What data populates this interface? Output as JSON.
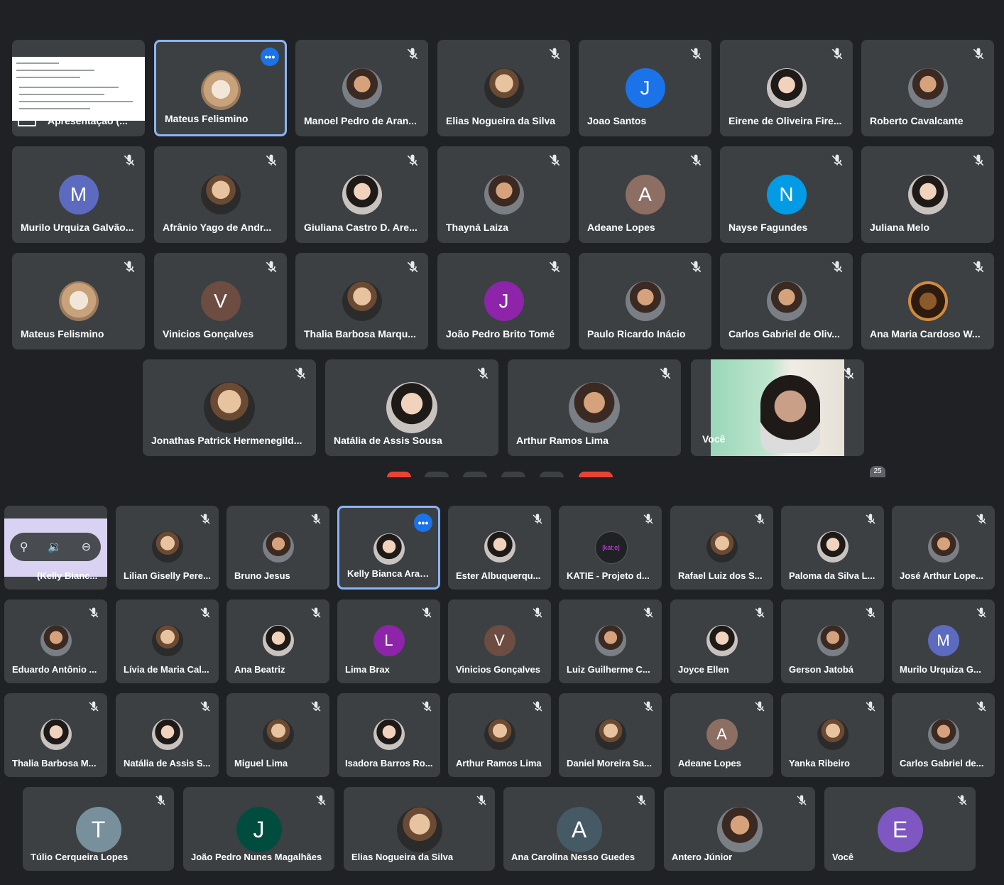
{
  "colors": {
    "background": "#202124",
    "tile": "#3c4043",
    "active_border": "#8ab4f8",
    "accent": "#1a73e8"
  },
  "top_grid": {
    "presentation": {
      "caption": "Apresentação (..."
    },
    "rows": [
      [
        {
          "name": "Mateus Felismino",
          "kind": "photo",
          "style": "cat",
          "active": true,
          "more": true
        },
        {
          "name": "Manoel Pedro de Aran...",
          "kind": "photo",
          "style": "p2"
        },
        {
          "name": "Elias Nogueira da Silva",
          "kind": "photo",
          "style": "p1"
        },
        {
          "name": "Joao Santos",
          "kind": "letter",
          "letter": "J",
          "color": "#1a73e8"
        },
        {
          "name": "Eirene de Oliveira Fire...",
          "kind": "photo",
          "style": "p3"
        },
        {
          "name": "Roberto Cavalcante",
          "kind": "photo",
          "style": "p2"
        }
      ],
      [
        {
          "name": "Murilo Urquiza Galvão...",
          "kind": "letter",
          "letter": "M",
          "color": "#5c6bc0"
        },
        {
          "name": "Afrânio Yago de Andr...",
          "kind": "photo",
          "style": "p1"
        },
        {
          "name": "Giuliana Castro D. Are...",
          "kind": "photo",
          "style": "p3"
        },
        {
          "name": "Thayná Laiza",
          "kind": "photo",
          "style": "p2"
        },
        {
          "name": "Adeane Lopes",
          "kind": "letter",
          "letter": "A",
          "color": "#8d6e63"
        },
        {
          "name": "Nayse Fagundes",
          "kind": "letter",
          "letter": "N",
          "color": "#039be5"
        },
        {
          "name": "Juliana Melo",
          "kind": "photo",
          "style": "p3"
        }
      ],
      [
        {
          "name": "Mateus Felismino",
          "kind": "photo",
          "style": "cat"
        },
        {
          "name": "Vinicios Gonçalves",
          "kind": "letter",
          "letter": "V",
          "color": "#6d4c41"
        },
        {
          "name": "Thalia Barbosa Marqu...",
          "kind": "photo",
          "style": "p1"
        },
        {
          "name": "João Pedro Brito Tomé",
          "kind": "letter",
          "letter": "J",
          "color": "#8e24aa"
        },
        {
          "name": "Paulo Ricardo Inácio",
          "kind": "photo",
          "style": "p2"
        },
        {
          "name": "Carlos Gabriel de Oliv...",
          "kind": "photo",
          "style": "p2"
        },
        {
          "name": "Ana Maria Cardoso W...",
          "kind": "photo",
          "style": "dog"
        }
      ],
      [
        {
          "name": "Jonathas Patrick Hermenegild...",
          "kind": "photo",
          "style": "p1"
        },
        {
          "name": "Natália de Assis Sousa",
          "kind": "photo",
          "style": "p3"
        },
        {
          "name": "Arthur Ramos Lima",
          "kind": "photo",
          "style": "p2"
        }
      ]
    ],
    "self_label": "Você",
    "participant_badge": "25"
  },
  "bottom_grid": {
    "presentation": {
      "caption": "(Kelly Bianc..."
    },
    "rows": [
      [
        {
          "name": "Lilian Giselly Pere...",
          "kind": "photo",
          "style": "p1"
        },
        {
          "name": "Bruno Jesus",
          "kind": "photo",
          "style": "p2"
        },
        {
          "name": "Kelly Bianca Araúj...",
          "kind": "photo",
          "style": "p3",
          "active": true,
          "more": true
        },
        {
          "name": "Ester Albuquerqu...",
          "kind": "photo",
          "style": "p3"
        },
        {
          "name": "KATIE - Projeto d...",
          "kind": "letter",
          "letter": "[kat;e]",
          "color": "#202124"
        },
        {
          "name": "Rafael Luiz dos S...",
          "kind": "photo",
          "style": "p1"
        },
        {
          "name": "Paloma da Silva L...",
          "kind": "photo",
          "style": "p3"
        },
        {
          "name": "José Arthur Lope...",
          "kind": "photo",
          "style": "p2"
        }
      ],
      [
        {
          "name": "Eduardo Antônio ...",
          "kind": "photo",
          "style": "p2"
        },
        {
          "name": "Lívia de Maria Cal...",
          "kind": "photo",
          "style": "p1"
        },
        {
          "name": "Ana Beatriz",
          "kind": "photo",
          "style": "p3"
        },
        {
          "name": "Lima Brax",
          "kind": "letter",
          "letter": "L",
          "color": "#8e24aa"
        },
        {
          "name": "Vinicios Gonçalves",
          "kind": "letter",
          "letter": "V",
          "color": "#6d4c41"
        },
        {
          "name": "Luiz Guilherme C...",
          "kind": "photo",
          "style": "p2"
        },
        {
          "name": "Joyce Ellen",
          "kind": "photo",
          "style": "p3"
        },
        {
          "name": "Gerson Jatobá",
          "kind": "photo",
          "style": "p2"
        },
        {
          "name": "Murilo Urquiza G...",
          "kind": "letter",
          "letter": "M",
          "color": "#5c6bc0"
        }
      ],
      [
        {
          "name": "Thalia Barbosa M...",
          "kind": "photo",
          "style": "p3"
        },
        {
          "name": "Natália de Assis S...",
          "kind": "photo",
          "style": "p3"
        },
        {
          "name": "Miguel Lima",
          "kind": "photo",
          "style": "p1"
        },
        {
          "name": "Isadora Barros Ro...",
          "kind": "photo",
          "style": "p3"
        },
        {
          "name": "Arthur Ramos Lima",
          "kind": "photo",
          "style": "p1"
        },
        {
          "name": "Daniel Moreira Sa...",
          "kind": "photo",
          "style": "p1"
        },
        {
          "name": "Adeane Lopes",
          "kind": "letter",
          "letter": "A",
          "color": "#8d6e63"
        },
        {
          "name": "Yanka Ribeiro",
          "kind": "photo",
          "style": "p1"
        },
        {
          "name": "Carlos Gabriel de...",
          "kind": "photo",
          "style": "p2"
        }
      ],
      [
        {
          "name": "Túlio Cerqueira Lopes",
          "kind": "letter",
          "letter": "T",
          "color": "#78909c"
        },
        {
          "name": "João Pedro Nunes Magalhães",
          "kind": "letter",
          "letter": "J",
          "color": "#004d40"
        },
        {
          "name": "Elias Nogueira da Silva",
          "kind": "photo",
          "style": "p1"
        },
        {
          "name": "Ana Carolina Nesso Guedes",
          "kind": "letter",
          "letter": "A",
          "color": "#455a64"
        },
        {
          "name": "Antero Júnior",
          "kind": "photo",
          "style": "p2"
        },
        {
          "name": "Você",
          "kind": "letter",
          "letter": "E",
          "color": "#7e57c2"
        }
      ]
    ]
  },
  "icons": {
    "mic_off": "mic-off-icon",
    "more": "more-options-icon",
    "pin": "pin-icon",
    "volume": "volume-icon",
    "remove": "remove-icon"
  },
  "glyphs": {
    "more": "•••",
    "pin": "⚲",
    "volume": "🔉",
    "remove": "⊖"
  }
}
